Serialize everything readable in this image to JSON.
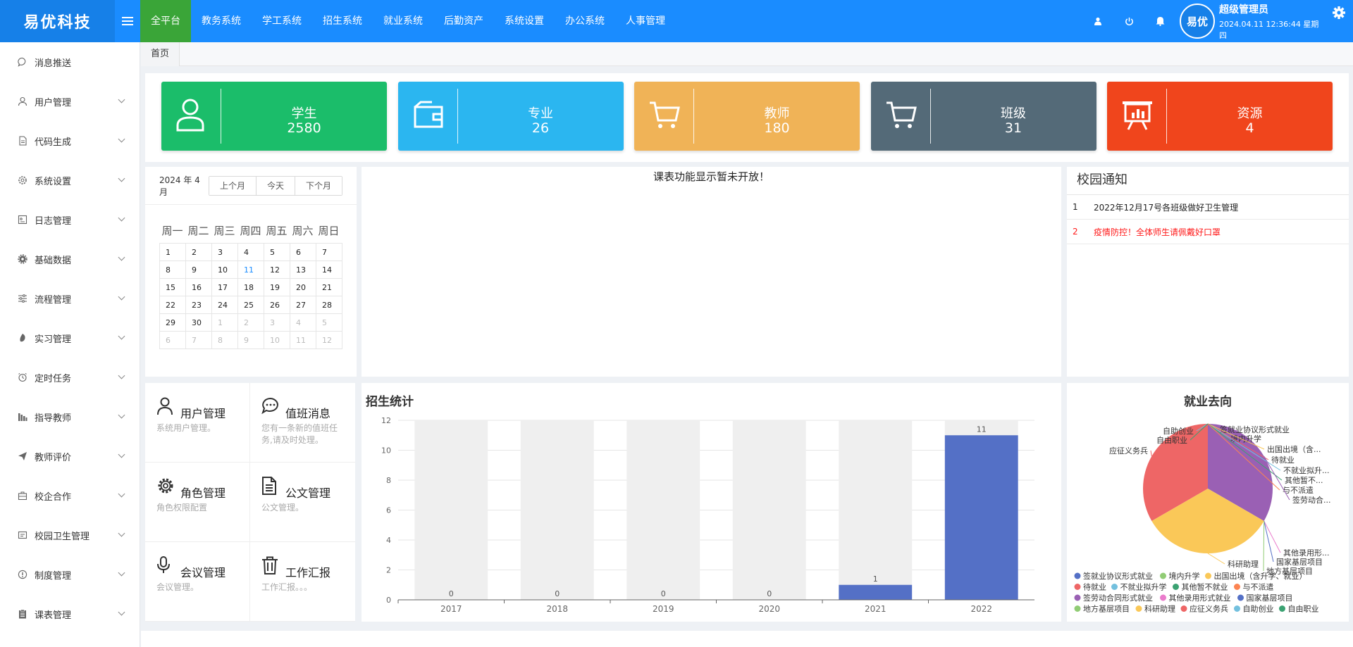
{
  "header": {
    "logo": "易优科技",
    "nav": [
      "全平台",
      "教务系统",
      "学工系统",
      "招生系统",
      "就业系统",
      "后勤资产",
      "系统设置",
      "办公系统",
      "人事管理"
    ],
    "avatar_text": "易优",
    "user_name": "超级管理员",
    "datetime": "2024.04.11 12:36:44 星期四",
    "icons": [
      "user-icon",
      "power-icon",
      "bell-icon",
      "gear-icon"
    ]
  },
  "sidebar": {
    "items": [
      {
        "label": "消息推送",
        "icon": "message-icon",
        "has_children": false
      },
      {
        "label": "用户管理",
        "icon": "user-icon",
        "has_children": true
      },
      {
        "label": "代码生成",
        "icon": "file-icon",
        "has_children": true
      },
      {
        "label": "系统设置",
        "icon": "settings-icon",
        "has_children": true
      },
      {
        "label": "日志管理",
        "icon": "log-icon",
        "has_children": true
      },
      {
        "label": "基础数据",
        "icon": "gear-icon",
        "has_children": true
      },
      {
        "label": "流程管理",
        "icon": "sliders-icon",
        "has_children": true
      },
      {
        "label": "实习管理",
        "icon": "leaf-icon",
        "has_children": true
      },
      {
        "label": "定时任务",
        "icon": "clock-icon",
        "has_children": true
      },
      {
        "label": "指导教师",
        "icon": "bar-chart-icon",
        "has_children": true
      },
      {
        "label": "教师评价",
        "icon": "send-icon",
        "has_children": true
      },
      {
        "label": "校企合作",
        "icon": "briefcase-icon",
        "has_children": true
      },
      {
        "label": "校园卫生管理",
        "icon": "sanitation-icon",
        "has_children": true
      },
      {
        "label": "制度管理",
        "icon": "alert-icon",
        "has_children": true
      },
      {
        "label": "课表管理",
        "icon": "clipboard-icon",
        "has_children": true
      }
    ]
  },
  "breadcrumb": {
    "home": "首页"
  },
  "stats": [
    {
      "label": "学生",
      "value": "2580",
      "color": "#1bbd6a",
      "icon": "person-icon"
    },
    {
      "label": "专业",
      "value": "26",
      "color": "#2bb6f0",
      "icon": "wallet-icon"
    },
    {
      "label": "教师",
      "value": "180",
      "color": "#f0b357",
      "icon": "cart-icon"
    },
    {
      "label": "班级",
      "value": "31",
      "color": "#546a78",
      "icon": "cart-icon"
    },
    {
      "label": "资源",
      "value": "4",
      "color": "#f0451c",
      "icon": "presentation-icon"
    }
  ],
  "calendar": {
    "title": "2024 年 4 月",
    "buttons": [
      "上个月",
      "今天",
      "下个月"
    ],
    "weekdays": [
      "周一",
      "周二",
      "周三",
      "周四",
      "周五",
      "周六",
      "周日"
    ],
    "weeks": [
      [
        "1",
        "2",
        "3",
        "4",
        "5",
        "6",
        "7"
      ],
      [
        "8",
        "9",
        "10",
        "11",
        "12",
        "13",
        "14"
      ],
      [
        "15",
        "16",
        "17",
        "18",
        "19",
        "20",
        "21"
      ],
      [
        "22",
        "23",
        "24",
        "25",
        "26",
        "27",
        "28"
      ],
      [
        "29",
        "30",
        "1",
        "2",
        "3",
        "4",
        "5"
      ],
      [
        "6",
        "7",
        "8",
        "9",
        "10",
        "11",
        "12"
      ]
    ],
    "today": "11"
  },
  "timetable": {
    "message": "课表功能显示暂未开放！"
  },
  "notices": {
    "title": "校园通知",
    "items": [
      {
        "num": "1",
        "text": "2022年12月17号各班级做好卫生管理",
        "color": "#222222"
      },
      {
        "num": "2",
        "text": "疫情防控！全体师生请佩戴好口罩",
        "color": "#ff1a1a"
      }
    ]
  },
  "quick": [
    {
      "title": "用户管理",
      "desc": "系统用户管理。",
      "icon": "user-icon"
    },
    {
      "title": "值班消息",
      "desc": "您有一条新的值班任务,请及时处理。",
      "icon": "chat-icon"
    },
    {
      "title": "角色管理",
      "desc": "角色权限配置",
      "icon": "gear-icon"
    },
    {
      "title": "公文管理",
      "desc": "公文管理。",
      "icon": "document-icon"
    },
    {
      "title": "会议管理",
      "desc": "会议管理。",
      "icon": "microphone-icon"
    },
    {
      "title": "工作汇报",
      "desc": "工作汇报。。。",
      "icon": "trash-icon"
    }
  ],
  "chart_data": [
    {
      "type": "bar",
      "title": "招生统计",
      "categories": [
        "2017",
        "2018",
        "2019",
        "2020",
        "2021",
        "2022"
      ],
      "values": [
        0,
        0,
        0,
        0,
        1,
        11
      ],
      "ylim": [
        0,
        12
      ],
      "yticks": [
        0,
        2,
        4,
        6,
        8,
        10,
        12
      ],
      "bar_color": "#5470c6",
      "background_color": "#efefef",
      "grid": true
    },
    {
      "type": "pie",
      "title": "就业去向",
      "labels": [
        "签就业协议形式就业",
        "境内升学",
        "出国出境（含升学、就业）",
        "待就业",
        "不就业拟升学",
        "其他暂不就业",
        "与不派遣",
        "签劳动合同形式就业",
        "其他录用形式就业",
        "国家基层项目",
        "地方基层项目",
        "科研助理",
        "应征义务兵",
        "自助创业",
        "自由职业"
      ],
      "callout_labels": [
        "签就业协议形式就业",
        "境内升学",
        "出国出境（含...",
        "待就业",
        "不就业拟升...",
        "其他暂不...",
        "与不派遣",
        "签劳动合...",
        "其他录用形...",
        "国家基层项目",
        "地方基层项目",
        "科研助理",
        "应征义务兵",
        "自助创业",
        "自由职业"
      ],
      "values": [
        0,
        0,
        0,
        0,
        0,
        0,
        0,
        1,
        0,
        0,
        0,
        1,
        1,
        0,
        0
      ],
      "colors": [
        "#5470c6",
        "#91cc75",
        "#fac858",
        "#ee6666",
        "#73c0de",
        "#3ba272",
        "#fc8452",
        "#9a60b4",
        "#ea7ccc",
        "#5470c6",
        "#91cc75",
        "#fac858",
        "#ee6666",
        "#73c0de",
        "#3ba272"
      ],
      "legend_position": "bottom"
    }
  ]
}
